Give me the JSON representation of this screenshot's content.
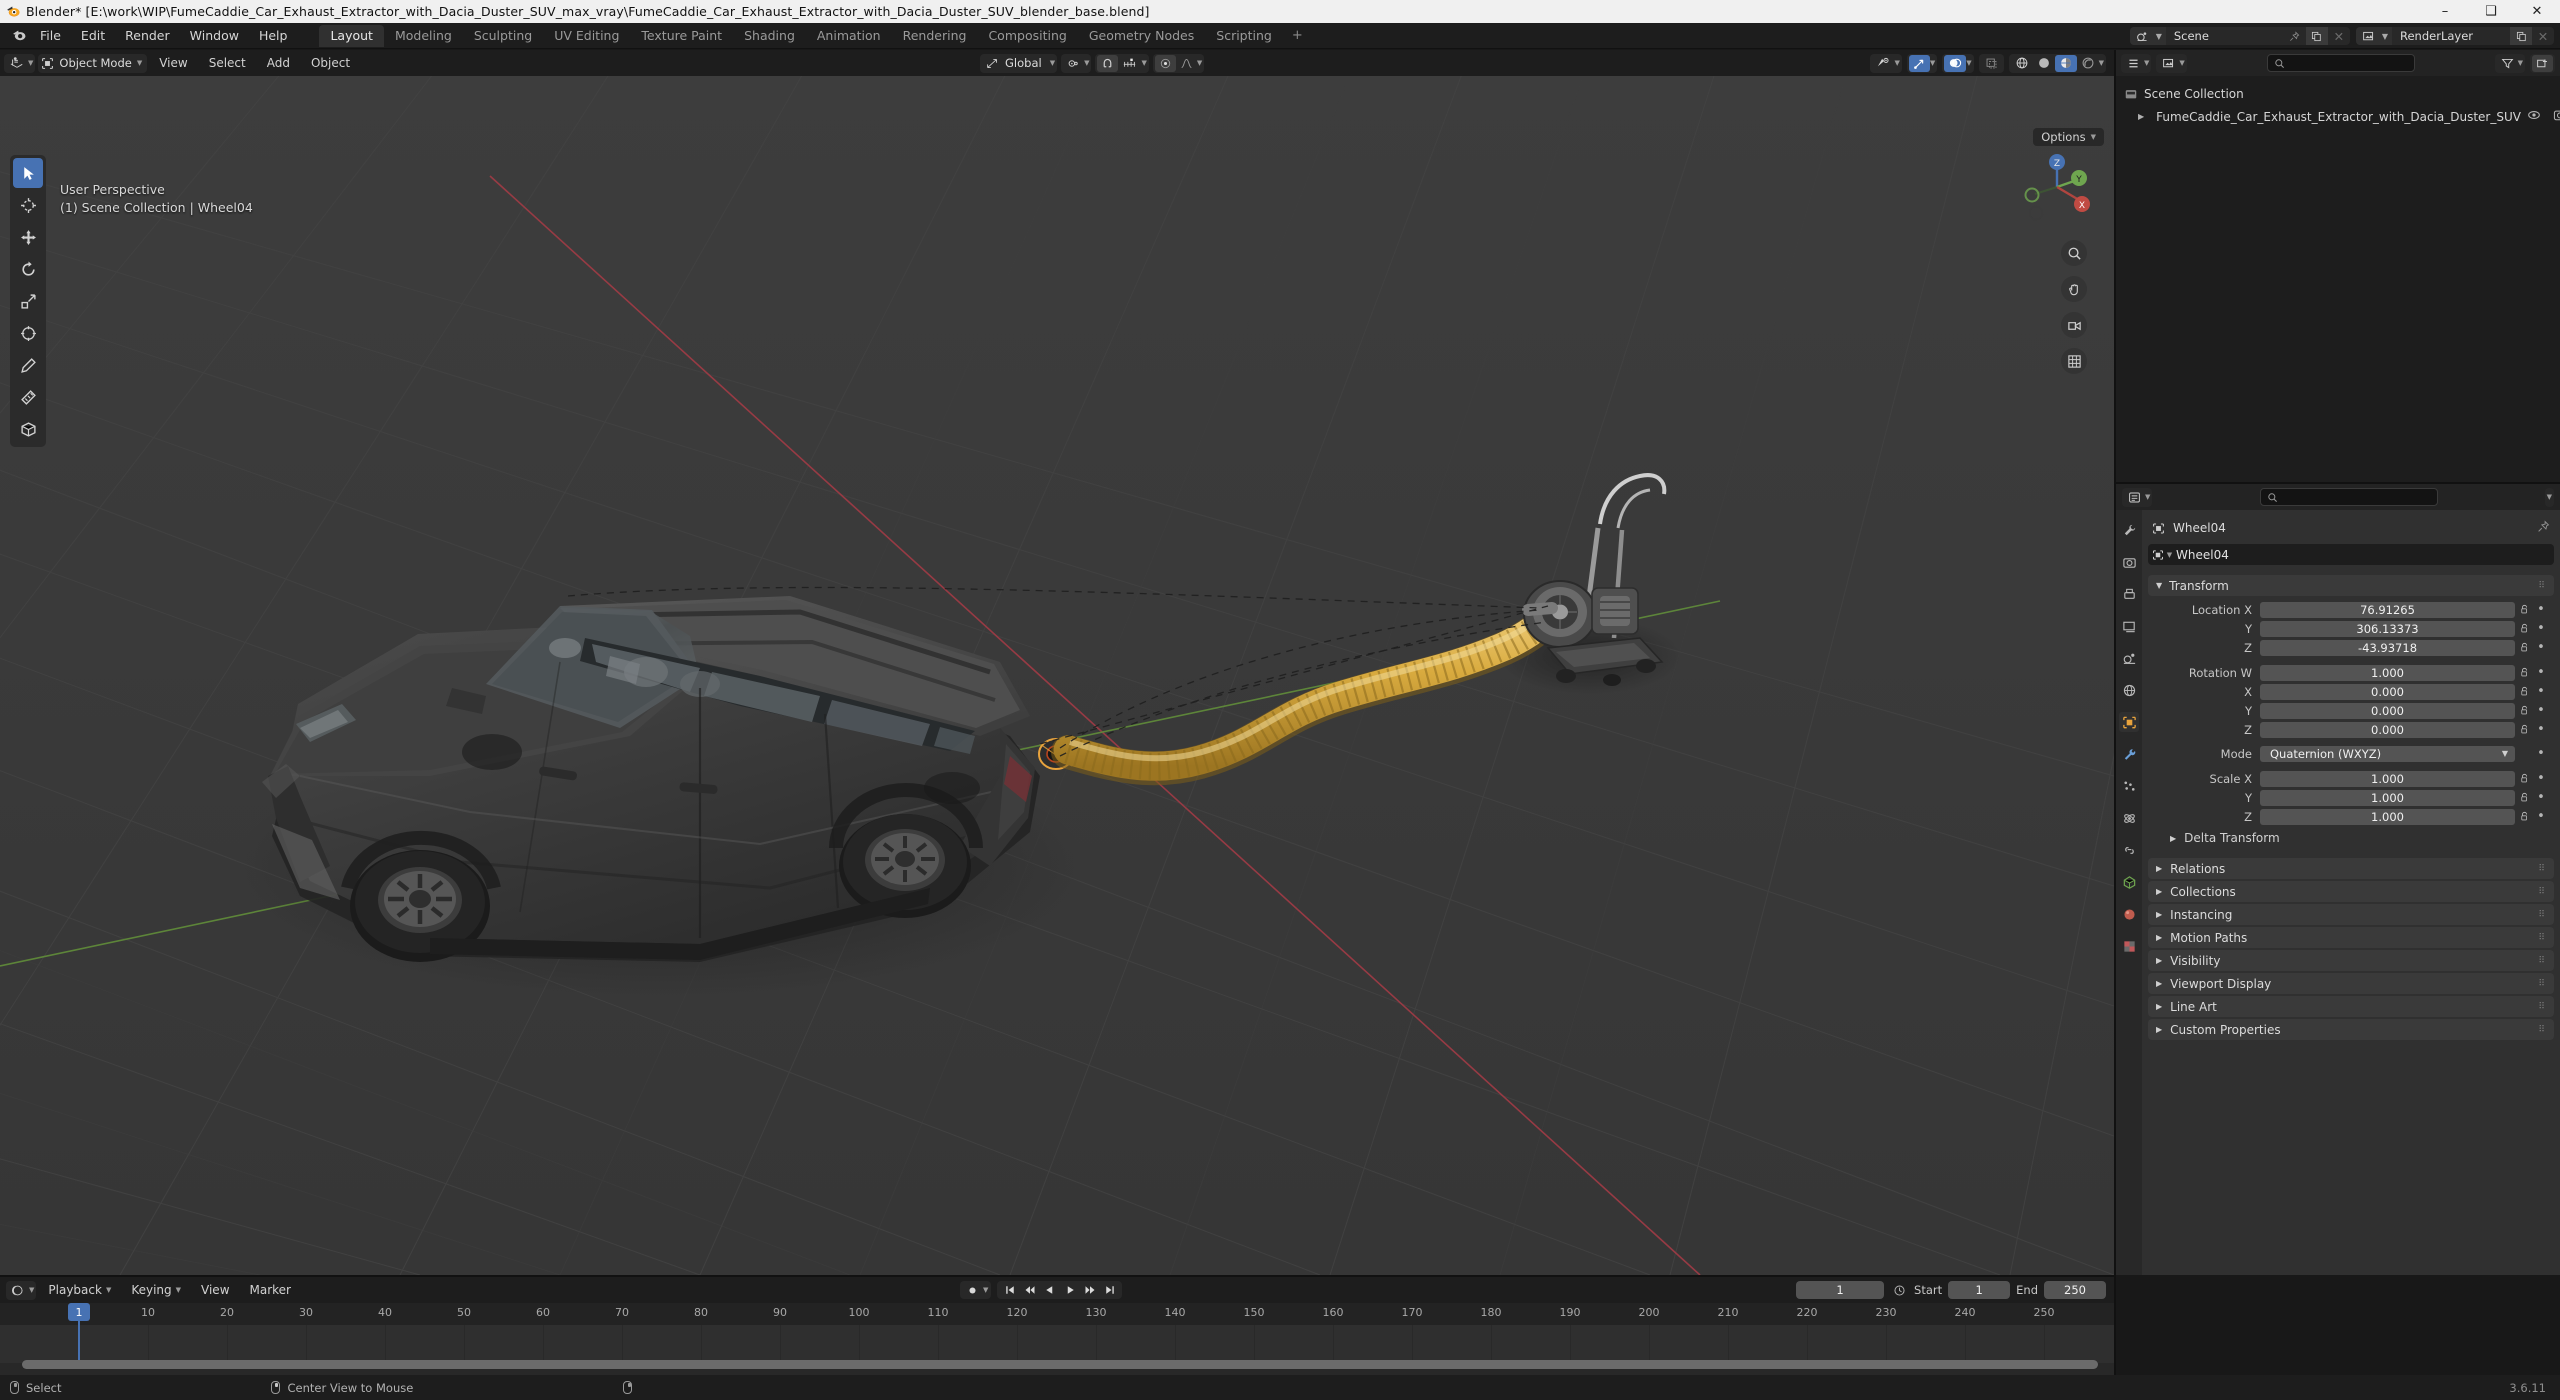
{
  "window": {
    "title": "Blender* [E:\\work\\WIP\\FumeCaddie_Car_Exhaust_Extractor_with_Dacia_Duster_SUV_max_vray\\FumeCaddie_Car_Exhaust_Extractor_with_Dacia_Duster_SUV_blender_base.blend]",
    "minimize": "–",
    "maximize": "❑",
    "close": "✕",
    "app_icon": "blender-logo-icon"
  },
  "topbar": {
    "menus": [
      "File",
      "Edit",
      "Render",
      "Window",
      "Help"
    ],
    "workspace_tabs": [
      {
        "label": "Layout",
        "active": true
      },
      {
        "label": "Modeling",
        "active": false
      },
      {
        "label": "Sculpting",
        "active": false
      },
      {
        "label": "UV Editing",
        "active": false
      },
      {
        "label": "Texture Paint",
        "active": false
      },
      {
        "label": "Shading",
        "active": false
      },
      {
        "label": "Animation",
        "active": false
      },
      {
        "label": "Rendering",
        "active": false
      },
      {
        "label": "Compositing",
        "active": false
      },
      {
        "label": "Geometry Nodes",
        "active": false
      },
      {
        "label": "Scripting",
        "active": false
      }
    ],
    "add_workspace": "+",
    "scene": {
      "label": "Scene",
      "icon": "scene-icon",
      "pin_icon": "pin-icon",
      "new_icon": "new-copy-icon",
      "unlink_icon": "x-icon"
    },
    "view_layer": {
      "label": "RenderLayer",
      "icon": "view-layer-icon",
      "new_icon": "new-copy-icon",
      "unlink_icon": "x-icon"
    }
  },
  "viewport": {
    "editor_type_icon": "editor-type-3dview-icon",
    "mode": "Object Mode",
    "mode_icon": "object-mode-icon",
    "menus": [
      "View",
      "Select",
      "Add",
      "Object"
    ],
    "transform_orientation": "Global",
    "snap_icon": "magnet-icon",
    "proportional_icon": "proportional-edit-icon",
    "overlay_text_line1": "User Perspective",
    "overlay_text_line2": "(1) Scene Collection | Wheel04",
    "options_label": "Options",
    "gizmo_axes": [
      "X",
      "Y",
      "Z"
    ],
    "tools": [
      {
        "name": "tweak-tool",
        "icon": "cursor-arrow-icon",
        "active": true
      },
      {
        "name": "cursor-tool",
        "icon": "3d-cursor-icon",
        "active": false
      },
      {
        "name": "move-tool",
        "icon": "move-icon",
        "active": false
      },
      {
        "name": "rotate-tool",
        "icon": "rotate-icon",
        "active": false
      },
      {
        "name": "scale-tool",
        "icon": "scale-icon",
        "active": false
      },
      {
        "name": "transform-tool",
        "icon": "transform-icon",
        "active": false
      },
      {
        "name": "annotate-tool",
        "icon": "pencil-icon",
        "active": false
      },
      {
        "name": "measure-tool",
        "icon": "ruler-icon",
        "active": false
      },
      {
        "name": "add-cube-tool",
        "icon": "add-cube-icon",
        "active": false
      }
    ],
    "nav_buttons": [
      {
        "name": "zoom-view-button",
        "icon": "magnifier-icon"
      },
      {
        "name": "pan-view-button",
        "icon": "hand-icon"
      },
      {
        "name": "camera-view-button",
        "icon": "camera-icon"
      },
      {
        "name": "toggle-ortho-button",
        "icon": "grid-icon"
      }
    ],
    "shading_modes": [
      "wireframe",
      "solid",
      "material-preview",
      "rendered"
    ],
    "active_shading": "material-preview"
  },
  "outliner": {
    "display_mode": "View Layer",
    "search_placeholder": "",
    "filter_icon": "filter-icon",
    "new_collection_icon": "new-collection-icon",
    "rows": [
      {
        "label": "Scene Collection",
        "icon": "collection-icon",
        "indent": 0,
        "expand": "",
        "eye": false
      },
      {
        "label": "FumeCaddie_Car_Exhaust_Extractor_with_Dacia_Duster_SUV",
        "icon": "empty-axis-icon",
        "indent": 1,
        "expand": "▶",
        "eye": true
      }
    ]
  },
  "properties": {
    "search_placeholder": "",
    "breadcrumb_object": "Wheel04",
    "object_name": "Wheel04",
    "tabs": [
      {
        "name": "tool-properties-tab",
        "icon": "tool-icon",
        "active": false
      },
      {
        "name": "render-properties-tab",
        "icon": "camera-back-icon",
        "active": false
      },
      {
        "name": "output-properties-tab",
        "icon": "printer-icon",
        "active": false
      },
      {
        "name": "view-layer-properties-tab",
        "icon": "images-icon",
        "active": false
      },
      {
        "name": "scene-properties-tab",
        "icon": "cone-sphere-icon",
        "active": false
      },
      {
        "name": "world-properties-tab",
        "icon": "world-icon",
        "active": false
      },
      {
        "name": "object-properties-tab",
        "icon": "orange-square-icon",
        "active": true
      },
      {
        "name": "modifier-properties-tab",
        "icon": "wrench-icon",
        "active": false
      },
      {
        "name": "particle-properties-tab",
        "icon": "particles-icon",
        "active": false
      },
      {
        "name": "physics-properties-tab",
        "icon": "physics-icon",
        "active": false
      },
      {
        "name": "constraint-properties-tab",
        "icon": "constraint-icon",
        "active": false
      },
      {
        "name": "data-properties-tab",
        "icon": "mesh-data-icon",
        "active": false
      },
      {
        "name": "material-properties-tab",
        "icon": "material-sphere-icon",
        "active": false
      },
      {
        "name": "texture-properties-tab",
        "icon": "checker-icon",
        "active": false
      }
    ],
    "transform": {
      "title": "Transform",
      "fields": [
        {
          "label": "Location X",
          "value": "76.91265"
        },
        {
          "label": "Y",
          "value": "306.13373"
        },
        {
          "label": "Z",
          "value": "-43.93718"
        }
      ],
      "rotation": [
        {
          "label": "Rotation W",
          "value": "1.000"
        },
        {
          "label": "X",
          "value": "0.000"
        },
        {
          "label": "Y",
          "value": "0.000"
        },
        {
          "label": "Z",
          "value": "0.000"
        }
      ],
      "mode_label": "Mode",
      "mode_value": "Quaternion (WXYZ)",
      "scale": [
        {
          "label": "Scale X",
          "value": "1.000"
        },
        {
          "label": "Y",
          "value": "1.000"
        },
        {
          "label": "Z",
          "value": "1.000"
        }
      ],
      "delta_transform": "Delta Transform"
    },
    "panels": [
      "Relations",
      "Collections",
      "Instancing",
      "Motion Paths",
      "Visibility",
      "Viewport Display",
      "Line Art",
      "Custom Properties"
    ]
  },
  "timeline": {
    "editor_icon": "timeline-icon",
    "menus": [
      "Playback",
      "Keying",
      "View",
      "Marker"
    ],
    "auto_key_icon": "record-icon",
    "transport": [
      "jump-start",
      "prev-keyframe",
      "play-reverse",
      "play",
      "next-keyframe",
      "jump-end"
    ],
    "current_frame": "1",
    "start_label": "Start",
    "start_value": "1",
    "end_label": "End",
    "end_value": "250",
    "ticks": [
      10,
      20,
      30,
      40,
      50,
      60,
      70,
      80,
      90,
      100,
      110,
      120,
      130,
      140,
      150,
      160,
      170,
      180,
      190,
      200,
      210,
      220,
      230,
      240,
      250
    ],
    "playhead_frame": "1"
  },
  "statusbar": {
    "items": [
      {
        "icon": "mouse-left-icon",
        "label": "Select"
      },
      {
        "icon": "mouse-middle-icon",
        "label": "Center View to Mouse"
      },
      {
        "icon": "mouse-right-icon",
        "label": ""
      }
    ],
    "version": "3.6.11"
  },
  "colors": {
    "accent_blue": "#4772b3",
    "viewport_bg": "#393939",
    "panel_bg": "#303030",
    "header_bg": "#1d1d1d",
    "hose_yellow": "#d4a73c",
    "grid_x_axis": "#9b3a46",
    "grid_y_axis": "#5f8a3a",
    "selected_outline": "#e8a33d"
  }
}
